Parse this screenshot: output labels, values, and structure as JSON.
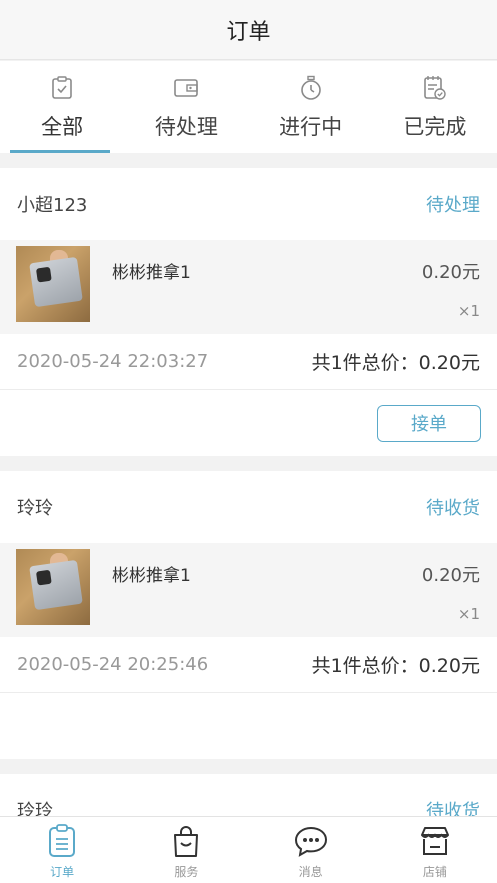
{
  "header": {
    "title": "订单"
  },
  "tabs": [
    {
      "label": "全部",
      "icon": "clipboard-check-icon",
      "active": true
    },
    {
      "label": "待处理",
      "icon": "wallet-icon",
      "active": false
    },
    {
      "label": "进行中",
      "icon": "stopwatch-icon",
      "active": false
    },
    {
      "label": "已完成",
      "icon": "notepad-check-icon",
      "active": false
    }
  ],
  "orders": [
    {
      "shop": "小超123",
      "status": "待处理",
      "item_name": "彬彬推拿1",
      "price": "0.20元",
      "qty": "×1",
      "time": "2020-05-24 22:03:27",
      "total": "共1件总价：0.20元",
      "action": "接单"
    },
    {
      "shop": "玲玲",
      "status": "待收货",
      "item_name": "彬彬推拿1",
      "price": "0.20元",
      "qty": "×1",
      "time": "2020-05-24 20:25:46",
      "total": "共1件总价：0.20元"
    },
    {
      "shop": "玲玲",
      "status": "待收货"
    }
  ],
  "bottom_nav": [
    {
      "label": "订单",
      "icon": "order-list-icon",
      "active": true
    },
    {
      "label": "服务",
      "icon": "shopping-bag-icon",
      "active": false
    },
    {
      "label": "消息",
      "icon": "chat-bubble-icon",
      "active": false
    },
    {
      "label": "店铺",
      "icon": "storefront-icon",
      "active": false
    }
  ],
  "colors": {
    "accent": "#5aa9c9",
    "icon_gray": "#8a8a8a"
  }
}
